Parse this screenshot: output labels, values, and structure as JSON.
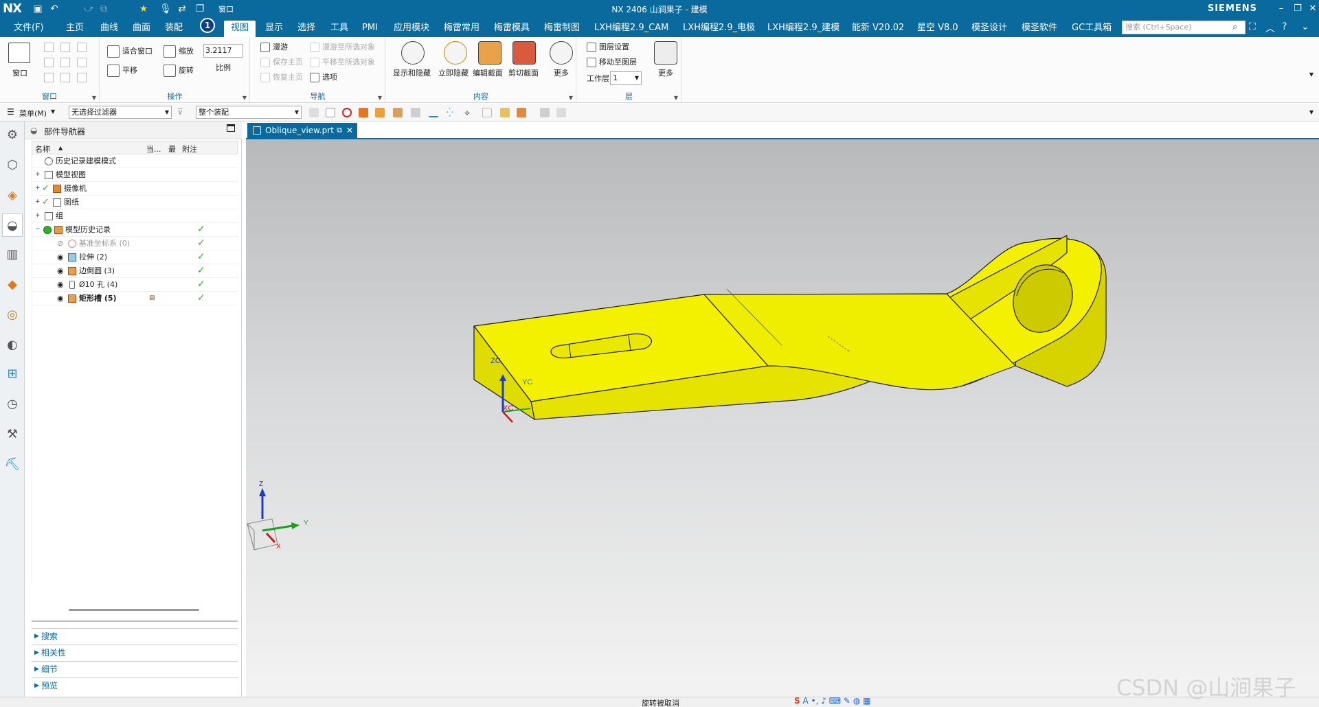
{
  "app": {
    "logo": "NX",
    "title": "NX 2406 山涧果子 - 建模",
    "brand": "SIEMENS",
    "quick_window_label": "窗口"
  },
  "menu": {
    "file": "文件(F)",
    "tabs": [
      "主页",
      "曲线",
      "曲面",
      "装配",
      "视图",
      "显示",
      "选择",
      "工具",
      "PMI",
      "应用模块",
      "梅雷常用",
      "梅雷模具",
      "梅雷制图",
      "LXH编程2.9_CAM",
      "LXH编程2.9_电极",
      "LXH编程2.9_建模",
      "能新 V20.02",
      "星空 V8.0",
      "模圣设计",
      "模圣软件",
      "GC工具箱"
    ],
    "active_tab": "视图",
    "badge": "1",
    "search_placeholder": "搜索 (Ctrl+Space)"
  },
  "ribbon": {
    "window_group": {
      "big_label": "窗口",
      "label": "窗口"
    },
    "operate_group": {
      "fit": "适合窗口",
      "zoom": "缩放",
      "zoom_value": "3.2117",
      "scale": "比例",
      "pan": "平移",
      "rotate": "旋转",
      "label": "操作"
    },
    "nav_group": {
      "walk": "漫游",
      "walk_to_obj": "漫游至所选对象",
      "save_home": "保存主页",
      "pan_to_obj": "平移至所选对象",
      "restore_home": "恢复主页",
      "options": "选项",
      "label": "导航"
    },
    "content_group": {
      "show_hide": "显示和隐藏",
      "hide_now": "立即隐藏",
      "edit_section": "编辑截面",
      "clip_section": "剪切截面",
      "more": "更多",
      "label": "内容"
    },
    "layer_group": {
      "layer_settings": "图层设置",
      "move_to_layer": "移动至图层",
      "work_layer": "工作层",
      "work_layer_value": "1",
      "more": "更多",
      "label": "层"
    }
  },
  "selbar": {
    "menu": "菜单(M)",
    "filter": "无选择过滤器",
    "scope": "整个装配"
  },
  "navigator": {
    "title": "部件导航器",
    "columns": {
      "name": "名称",
      "current": "当...",
      "latest": "最",
      "note": "附注"
    },
    "rows": [
      {
        "label": "历史记录建模模式"
      },
      {
        "label": "模型视图"
      },
      {
        "label": "摄像机"
      },
      {
        "label": "图纸"
      },
      {
        "label": "组"
      },
      {
        "label": "模型历史记录"
      },
      {
        "label": "基准坐标系 (0)"
      },
      {
        "label": "拉伸 (2)"
      },
      {
        "label": "边倒圆 (3)"
      },
      {
        "label": "Ø10 孔 (4)"
      },
      {
        "label": "矩形槽 (5)"
      }
    ],
    "sections": [
      "搜索",
      "相关性",
      "细节",
      "预览"
    ]
  },
  "document": {
    "tab_name": "Oblique_view.prt"
  },
  "viewport": {
    "wcs": {
      "zc": "ZC",
      "yc": "YC",
      "xc": "XC"
    },
    "triad": {
      "z": "Z",
      "y": "Y",
      "x": "X"
    },
    "model_color": "#f3f100"
  },
  "status": {
    "message": "旋转被取消",
    "watermark": "CSDN @山涧果子"
  }
}
